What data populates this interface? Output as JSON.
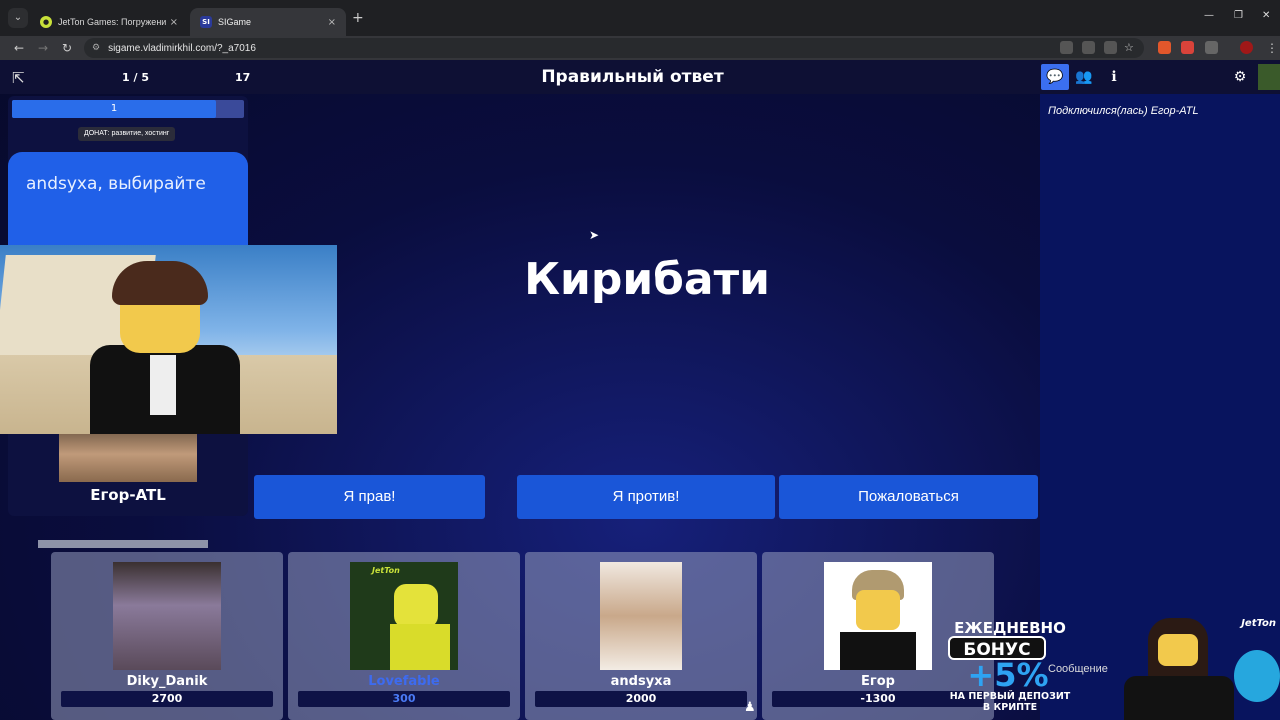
{
  "browser": {
    "tabs": [
      {
        "title": "JetTon Games: Погружение в м",
        "active": false
      },
      {
        "title": "SIGame",
        "active": true
      }
    ],
    "url": "sigame.vladimirkhil.com/?_a7016"
  },
  "game": {
    "round_counter": "1 / 5",
    "top_score": "17",
    "stage_title": "Правильный ответ",
    "timer_value": "1",
    "timer_level_percent": 88,
    "donate_label": "ДОНАТ: развитие, хостинг",
    "show_card_text": "andsyxa, выбирайте",
    "leader_name": "Егор-ATL",
    "answer": "Кирибати",
    "buttons": {
      "right": "Я прав!",
      "against": "Я против!",
      "complain": "Пожаловаться"
    }
  },
  "chat": {
    "tab_icons": [
      "chat-icon",
      "users-icon",
      "info-icon",
      "settings-icon"
    ],
    "messages": [
      "Подключился(лась) Егор-ATL"
    ],
    "input_placeholder": "Сообщение"
  },
  "players": [
    {
      "name": "Diky_Danik",
      "score": "2700"
    },
    {
      "name": "Lovefable",
      "score": "300"
    },
    {
      "name": "andsyxa",
      "score": "2000"
    },
    {
      "name": "Егор",
      "score": "-1300"
    }
  ],
  "ad": {
    "line1": "ЕЖЕДНЕВНО",
    "line2": "БОНУС",
    "line3": "+5%",
    "line4": "НА ПЕРВЫЙ ДЕПОЗИТ",
    "line5": "В КРИПТЕ",
    "brand": "JetTon"
  },
  "player_card_ad": {
    "brand": "JetTon"
  }
}
